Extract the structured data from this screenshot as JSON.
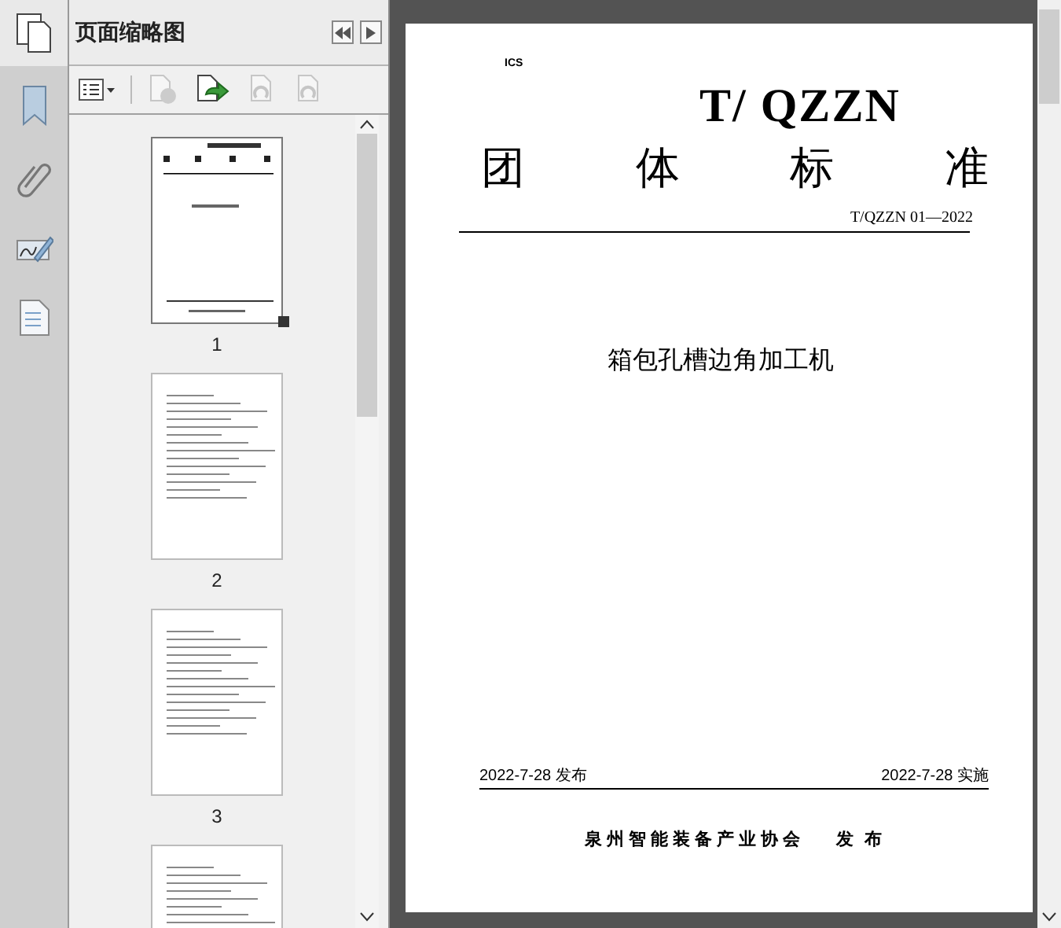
{
  "sidebar": {
    "title": "页面缩略图",
    "thumbnails": [
      {
        "page_number": "1",
        "selected": true,
        "kind": "cover"
      },
      {
        "page_number": "2",
        "selected": false,
        "kind": "text"
      },
      {
        "page_number": "3",
        "selected": false,
        "kind": "text"
      },
      {
        "selected": false,
        "kind": "text"
      }
    ]
  },
  "document": {
    "ics": "ICS",
    "org_code": "T/ QZZN",
    "heading": [
      "团",
      "体",
      "标",
      "准"
    ],
    "standard_number": "T/QZZN 01—2022",
    "title": "箱包孔槽边角加工机",
    "publish_date": "2022-7-28 发布",
    "effective_date": "2022-7-28 实施",
    "publisher": "泉州智能装备产业协会",
    "publisher_action": "发 布"
  }
}
